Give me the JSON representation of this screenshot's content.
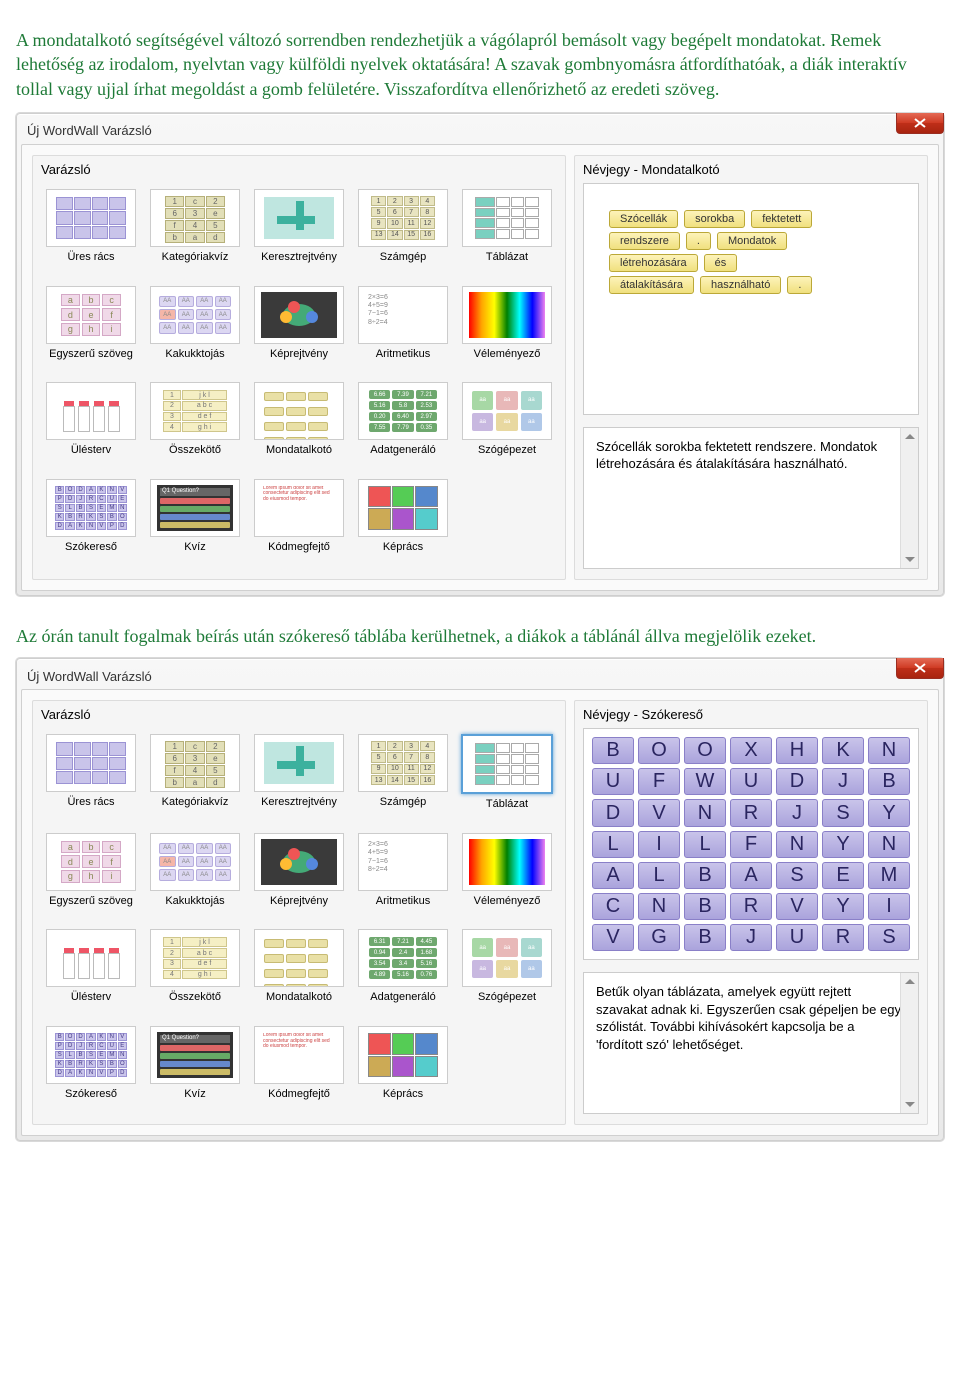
{
  "intro_text": "A mondatalkotó segítségével változó sorrendben rendezhetjük a vágólapról bemásolt vagy begépelt mondatokat. Remek lehetőség az irodalom, nyelvtan vagy külföldi nyelvek oktatására! A szavak gombnyomásra átfordíthatóak, a diák interaktív tollal vagy ujjal írhat megoldást a gomb felületére. Visszafordítva ellenőrizhető az eredeti szöveg.",
  "caption_text": "Az órán tanult fogalmak beírás után szókereső táblába kerülhetnek, a diákok a táblánál állva megjelölik ezeket.",
  "dialog_title": "Új WordWall Varázsló",
  "left_label": "Varázsló",
  "tiles": [
    {
      "label": "Üres rács"
    },
    {
      "label": "Kategóriakvíz"
    },
    {
      "label": "Keresztrejtvény"
    },
    {
      "label": "Számgép"
    },
    {
      "label": "Táblázat"
    },
    {
      "label": "Egyszerű szöveg"
    },
    {
      "label": "Kakukktojás"
    },
    {
      "label": "Képrejtvény"
    },
    {
      "label": "Aritmetikus"
    },
    {
      "label": "Véleményező"
    },
    {
      "label": "Ülésterv"
    },
    {
      "label": "Összekötő"
    },
    {
      "label": "Mondatalkotó"
    },
    {
      "label": "Adatgeneráló"
    },
    {
      "label": "Szógépezet"
    },
    {
      "label": "Szókereső"
    },
    {
      "label": "Kvíz"
    },
    {
      "label": "Kódmegfejtő"
    },
    {
      "label": "Képrács"
    }
  ],
  "dlg1": {
    "right_label": "Névjegy - Mondatalkotó",
    "words": [
      "Szócellák",
      "sorokba",
      "fektetett",
      "rendszere",
      ".",
      "Mondatok",
      "létrehozására",
      "és",
      "átalakítására",
      "használható",
      "."
    ],
    "desc": "Szócellák sorokba fektetett rendszere. Mondatok létrehozására és átalakítására használható."
  },
  "dlg2": {
    "right_label": "Névjegy - Szókereső",
    "grid": [
      [
        "B",
        "O",
        "O",
        "X",
        "H",
        "K",
        "N"
      ],
      [
        "U",
        "F",
        "W",
        "U",
        "D",
        "J",
        "B"
      ],
      [
        "D",
        "V",
        "N",
        "R",
        "J",
        "S",
        "Y"
      ],
      [
        "L",
        "I",
        "L",
        "F",
        "N",
        "Y",
        "N"
      ],
      [
        "A",
        "L",
        "B",
        "A",
        "S",
        "E",
        "M"
      ],
      [
        "C",
        "N",
        "B",
        "R",
        "V",
        "Y",
        "I"
      ],
      [
        "V",
        "G",
        "B",
        "J",
        "U",
        "R",
        "S"
      ]
    ],
    "desc": "Betűk olyan táblázata, amelyek együtt rejtett szavakat adnak ki. Egyszerűen csak gépeljen be egy szólistát. További kihívásokért kapcsolja be a 'fordított szó' lehetőséget."
  }
}
